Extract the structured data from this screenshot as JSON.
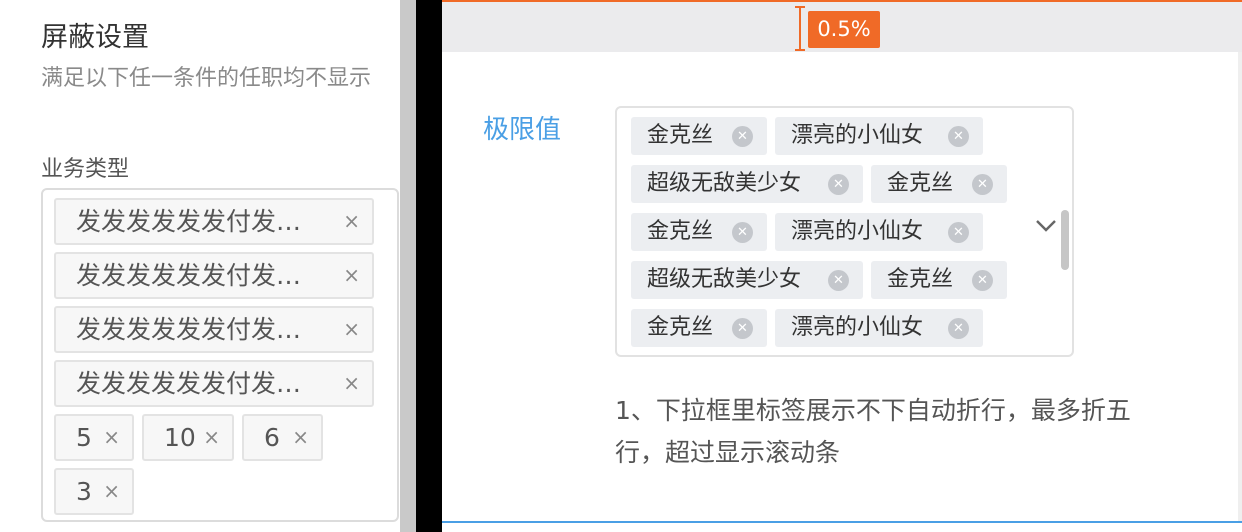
{
  "left": {
    "title": "屏蔽设置",
    "description": "满足以下任一条件的任职均不显示",
    "field_label": "业务类型",
    "tags": [
      {
        "label": "发发发发发发付发…"
      },
      {
        "label": "发发发发发发付发…"
      },
      {
        "label": "发发发发发发付发…"
      },
      {
        "label": "发发发发发发付发…"
      },
      {
        "label": "5"
      },
      {
        "label": "10"
      },
      {
        "label": "6"
      },
      {
        "label": "3"
      }
    ],
    "remove_glyph": "×"
  },
  "right": {
    "badge": "0.5%",
    "field_label": "极限值",
    "tags": [
      {
        "label": "金克丝"
      },
      {
        "label": "漂亮的小仙女"
      },
      {
        "label": "超级无敌美少女"
      },
      {
        "label": "金克丝"
      },
      {
        "label": "金克丝"
      },
      {
        "label": "漂亮的小仙女"
      },
      {
        "label": "超级无敌美少女"
      },
      {
        "label": "金克丝"
      },
      {
        "label": "金克丝"
      },
      {
        "label": "漂亮的小仙女"
      }
    ],
    "close_glyph": "✕",
    "note": "1、下拉框里标签展示不下自动折行，最多折五行，超过显示滚动条"
  },
  "colors": {
    "accent_orange": "#f06a27",
    "accent_blue": "#4a9fe5",
    "tag_bg": "#eceef1"
  },
  "icons": {
    "chevron": "chevron-down-icon",
    "tag_close": "close-circle-icon",
    "tag_remove": "close-icon"
  }
}
